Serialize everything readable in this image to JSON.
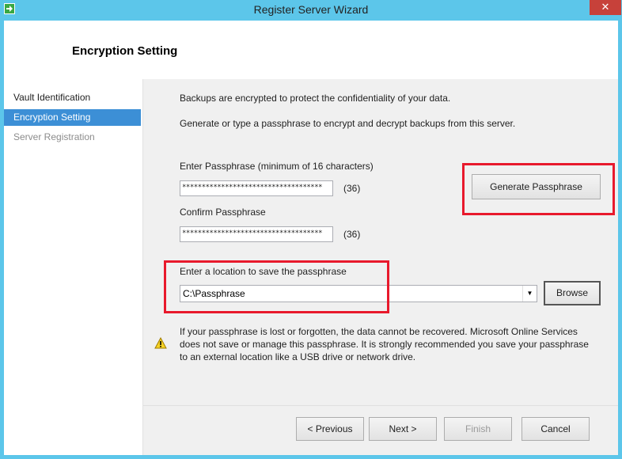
{
  "window": {
    "title": "Register Server Wizard",
    "close_label": "✕"
  },
  "header": {
    "title": "Encryption Setting"
  },
  "nav": {
    "items": [
      {
        "label": "Vault Identification",
        "state": "normal"
      },
      {
        "label": "Encryption Setting",
        "state": "selected"
      },
      {
        "label": "Server Registration",
        "state": "disabled"
      }
    ]
  },
  "content": {
    "intro1": "Backups are encrypted to protect the confidentiality of your data.",
    "intro2": "Generate or type a passphrase to encrypt and decrypt backups from this server.",
    "passphrase_label": "Enter Passphrase (minimum of 16 characters)",
    "passphrase_value": "************************************",
    "passphrase_count": "(36)",
    "confirm_label": "Confirm Passphrase",
    "confirm_value": "************************************",
    "confirm_count": "(36)",
    "generate_button": "Generate Passphrase",
    "location_label": "Enter a location to save the passphrase",
    "location_value": "C:\\Passphrase",
    "browse_button": "Browse",
    "warning": "If your passphrase is lost or forgotten, the data cannot be recovered. Microsoft Online Services does not save or manage this passphrase. It is strongly recommended you save your passphrase to an external location like a USB drive or network drive."
  },
  "footer": {
    "previous": "< Previous",
    "next": "Next >",
    "finish": "Finish",
    "cancel": "Cancel"
  },
  "colors": {
    "titlebar": "#5cc6ea",
    "nav_selected": "#3c8fd6",
    "highlight": "#e8192c",
    "close_button": "#c7413a"
  }
}
